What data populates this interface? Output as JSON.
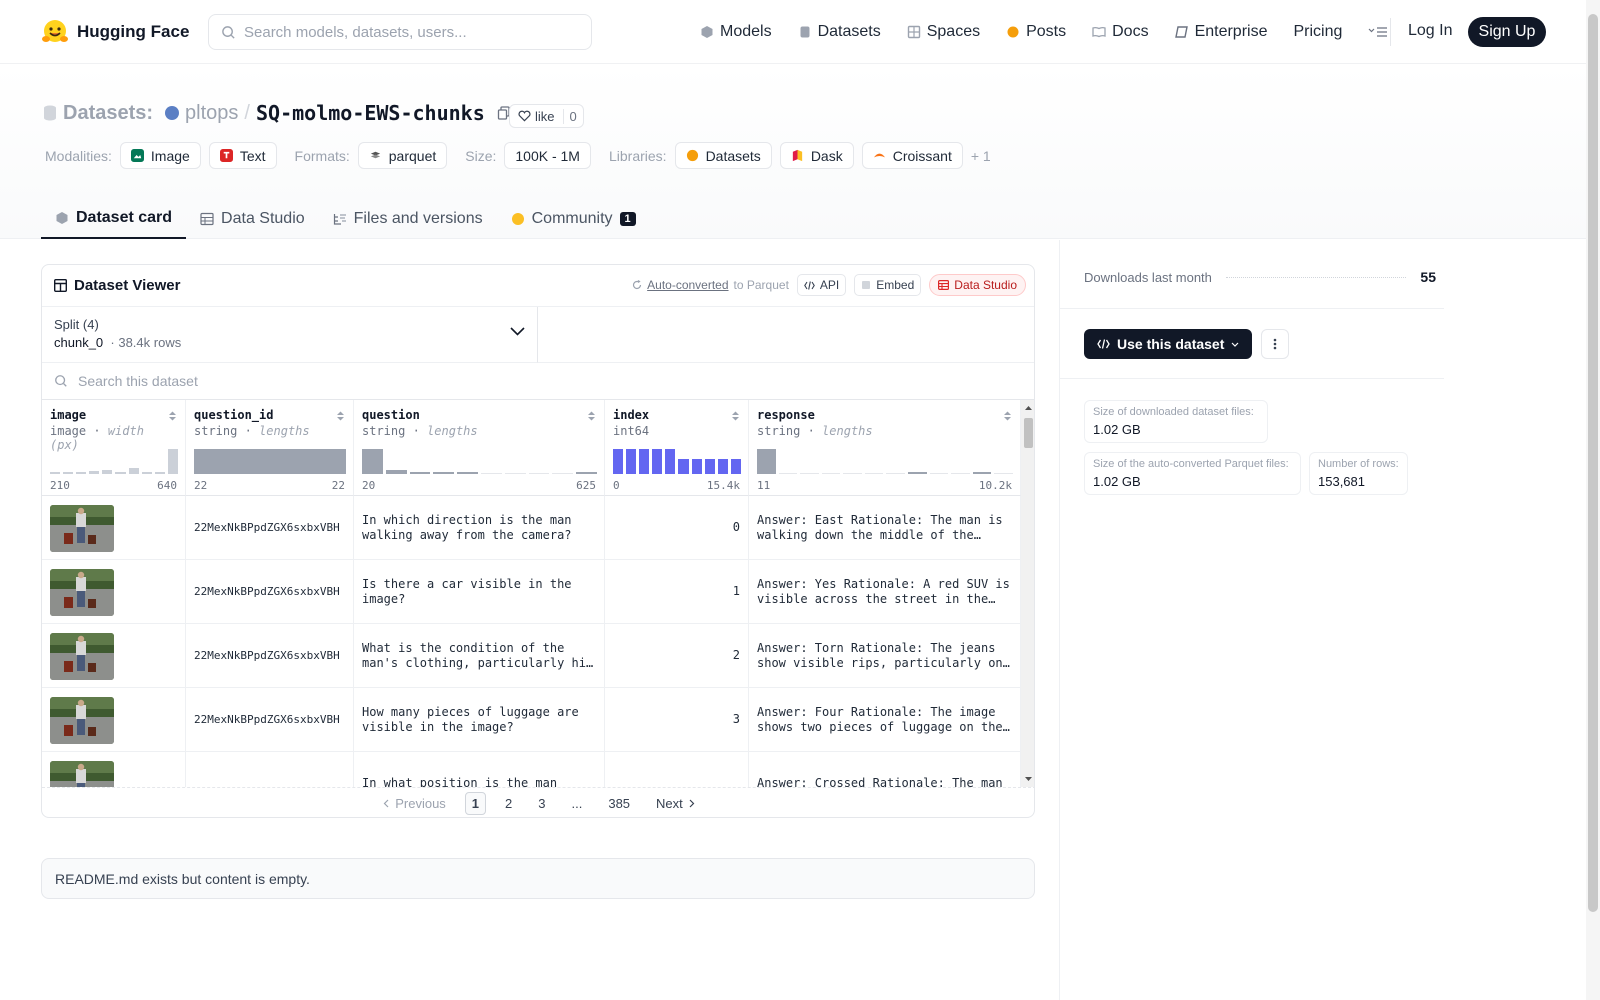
{
  "header": {
    "brand": "Hugging Face",
    "search_placeholder": "Search models, datasets, users...",
    "nav": [
      {
        "label": "Models",
        "icon": "cube-icon",
        "color": "#9ca3af"
      },
      {
        "label": "Datasets",
        "icon": "database-icon",
        "color": "#9ca3af"
      },
      {
        "label": "Spaces",
        "icon": "grid-icon",
        "color": "#9ca3af"
      },
      {
        "label": "Posts",
        "icon": "posts-icon",
        "color": "#f59e0b"
      },
      {
        "label": "Docs",
        "icon": "book-icon",
        "color": "#9ca3af"
      },
      {
        "label": "Enterprise",
        "icon": "enterprise-icon",
        "color": "#6b7280"
      },
      {
        "label": "Pricing",
        "icon": "",
        "color": ""
      }
    ],
    "login": "Log In",
    "signup": "Sign Up"
  },
  "dataset": {
    "section_label": "Datasets:",
    "owner": "pltops",
    "name": "SQ-molmo-EWS-chunks",
    "like_label": "like",
    "like_count": "0",
    "tags": {
      "modalities_label": "Modalities:",
      "modalities": [
        {
          "label": "Image",
          "color": "#047857"
        },
        {
          "label": "Text",
          "color": "#dc2626"
        }
      ],
      "formats_label": "Formats:",
      "formats": [
        {
          "label": "parquet"
        }
      ],
      "size_label": "Size:",
      "size": "100K - 1M",
      "libraries_label": "Libraries:",
      "libraries": [
        {
          "label": "Datasets",
          "color": "#f59e0b"
        },
        {
          "label": "Dask",
          "color": "#e11d48"
        },
        {
          "label": "Croissant",
          "color": "#f97316"
        }
      ],
      "more": "+ 1"
    }
  },
  "tabs": [
    {
      "label": "Dataset card",
      "active": true
    },
    {
      "label": "Data Studio",
      "active": false
    },
    {
      "label": "Files and versions",
      "active": false
    },
    {
      "label": "Community",
      "active": false,
      "badge": "1"
    }
  ],
  "viewer": {
    "title": "Dataset Viewer",
    "auto_link": "Auto-converted",
    "auto_suffix": "to Parquet",
    "api": "API",
    "embed": "Embed",
    "studio": "Data Studio",
    "split_label": "Split (4)",
    "split_name": "chunk_0",
    "split_rows": "38.4k rows",
    "search_placeholder": "Search this dataset",
    "columns": [
      {
        "name": "image",
        "type": "image",
        "hint": "width (px)",
        "min": "210",
        "max": "640",
        "hist": [
          0.08,
          0.08,
          0.08,
          0.12,
          0.15,
          0.1,
          0.25,
          0.08,
          0.1,
          1.0
        ],
        "color": "#cbd0d8"
      },
      {
        "name": "question_id",
        "type": "string",
        "hint": "lengths",
        "min": "22",
        "max": "22",
        "hist": [
          1.0
        ],
        "color": "#9ca3af"
      },
      {
        "name": "question",
        "type": "string",
        "hint": "lengths",
        "min": "20",
        "max": "625",
        "hist": [
          1.0,
          0.15,
          0.08,
          0.06,
          0.05,
          0,
          0,
          0,
          0,
          0.04
        ],
        "color": "#9ca3af"
      },
      {
        "name": "index",
        "type": "int64",
        "hint": "",
        "min": "0",
        "max": "15.4k",
        "hist": [
          1.0,
          1.0,
          1.0,
          1.0,
          1.0,
          0.62,
          0.62,
          0.62,
          0.62,
          0.62
        ],
        "color": "#6366f1"
      },
      {
        "name": "response",
        "type": "string",
        "hint": "lengths",
        "min": "11",
        "max": "10.2k",
        "hist": [
          1.0,
          0,
          0,
          0,
          0,
          0,
          0,
          0.05,
          0,
          0,
          0.05,
          0
        ],
        "color": "#9ca3af"
      }
    ],
    "rows": [
      {
        "question_id": "22MexNkBPpdZGX6sxbxVBH",
        "question": "In which direction is the man walking away from the camera?",
        "index": "0",
        "response": "Answer: East Rationale: The man is walking down the middle of the street away from the camera"
      },
      {
        "question_id": "22MexNkBPpdZGX6sxbxVBH",
        "question": "Is there a car visible in the image?",
        "index": "1",
        "response": "Answer: Yes Rationale: A red SUV is visible across the street in the background"
      },
      {
        "question_id": "22MexNkBPpdZGX6sxbxVBH",
        "question": "What is the condition of the man's clothing, particularly his jeans?",
        "index": "2",
        "response": "Answer: Torn Rationale: The jeans show visible rips, particularly on the knees"
      },
      {
        "question_id": "22MexNkBPpdZGX6sxbxVBH",
        "question": "How many pieces of luggage are visible in the image?",
        "index": "3",
        "response": "Answer: Four Rationale: The image shows two pieces of luggage on the ground and two more"
      },
      {
        "question_id": "",
        "question": "In what position is the man",
        "index": "",
        "response": "Answer: Crossed Rationale: The man"
      }
    ],
    "pager": {
      "prev": "Previous",
      "pages": [
        "1",
        "2",
        "3",
        "...",
        "385"
      ],
      "next": "Next"
    }
  },
  "readme": "README.md exists but content is empty.",
  "sidebar": {
    "downloads_label": "Downloads last month",
    "downloads": "55",
    "use_label": "Use this dataset",
    "size_dl_label": "Size of downloaded dataset files:",
    "size_dl": "1.02 GB",
    "size_pq_label": "Size of the auto-converted Parquet files:",
    "size_pq": "1.02 GB",
    "rows_label": "Number of rows:",
    "rows": "153,681"
  }
}
